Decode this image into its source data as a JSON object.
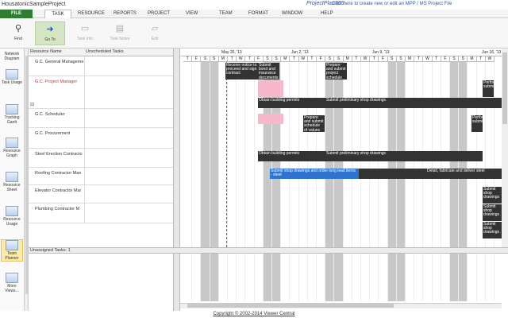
{
  "app": {
    "title": "HousatonicSampleProject",
    "logo_text": "ProjectPlan365",
    "promo_link": "Click here to create new or edit an MPP / MS Project File"
  },
  "menu": {
    "file": "FILE",
    "task": "TASK",
    "items": [
      "RESOURCE",
      "REPORTS",
      "PROJECT",
      "VIEW",
      "TEAM",
      "FORMAT",
      "WINDOW",
      "HELP"
    ]
  },
  "ribbon": {
    "buttons": [
      {
        "label": "Find",
        "icon": "binoculars-icon",
        "state": "enabled"
      },
      {
        "label": "Go To",
        "icon": "arrow-right-icon",
        "state": "selected"
      },
      {
        "label": "Task Info",
        "icon": "task-info-icon",
        "state": "disabled"
      },
      {
        "label": "Task Notes",
        "icon": "notes-icon",
        "state": "disabled"
      },
      {
        "label": "Edit",
        "icon": "edit-icon",
        "state": "disabled"
      }
    ]
  },
  "views": [
    {
      "label": "Network Diagram"
    },
    {
      "label": "Task Usage"
    },
    {
      "label": "Tracking Gantt"
    },
    {
      "label": "Resource Graph"
    },
    {
      "label": "Resource Sheet"
    },
    {
      "label": "Resource Usage"
    },
    {
      "label": "Team Planner"
    },
    {
      "label": "More Views..."
    }
  ],
  "grid": {
    "col_resource": "Resource Name",
    "col_unscheduled": "Unscheduled Tasks",
    "rows": [
      {
        "name": "G.C. General Manageme"
      },
      {
        "name": "G.C. Project Manager",
        "color": "#d03030"
      },
      {
        "name": "G.C. Scheduler"
      },
      {
        "name": "G.C. Procurement"
      },
      {
        "name": "Steel Erection Contracto"
      },
      {
        "name": "Roofing Contractor Man"
      },
      {
        "name": "Elevator Contractor Mar"
      },
      {
        "name": "Plumbing Contractor M"
      }
    ]
  },
  "timeline": {
    "weeks": [
      "May 26, '13",
      "Jun 2, '13",
      "Jun 9, '13",
      "Jun 16, '13"
    ],
    "days": [
      "T",
      "F",
      "S",
      "S",
      "M",
      "T",
      "W",
      "T",
      "F",
      "S",
      "S",
      "M",
      "T",
      "W",
      "T",
      "F",
      "S",
      "S",
      "M",
      "T",
      "W",
      "T",
      "F",
      "S",
      "S",
      "M",
      "T",
      "W",
      "T",
      "F",
      "S",
      "S",
      "M",
      "T",
      "W"
    ]
  },
  "tasks": [
    {
      "label": "Receive notice to proceed and sign contract"
    },
    {
      "label": "Submit bond and insurance documents"
    },
    {
      "label": "Prepare and submit project schedule"
    },
    {
      "label": "Perform submittals"
    },
    {
      "label": "Obtain building permits"
    },
    {
      "label": "Submit preliminary shop drawings"
    },
    {
      "label": "Perform submittals"
    },
    {
      "label": "Prepare and submit schedule of values"
    },
    {
      "label": "Submit shop drawings and order long lead items - steel"
    },
    {
      "label": "Detail, fabricate and deliver steel"
    },
    {
      "label": "Submit shop drawings"
    }
  ],
  "unassigned": "Unassigned Tasks: 1",
  "footer": "Copyright © 2002-2014 Viewer Central"
}
